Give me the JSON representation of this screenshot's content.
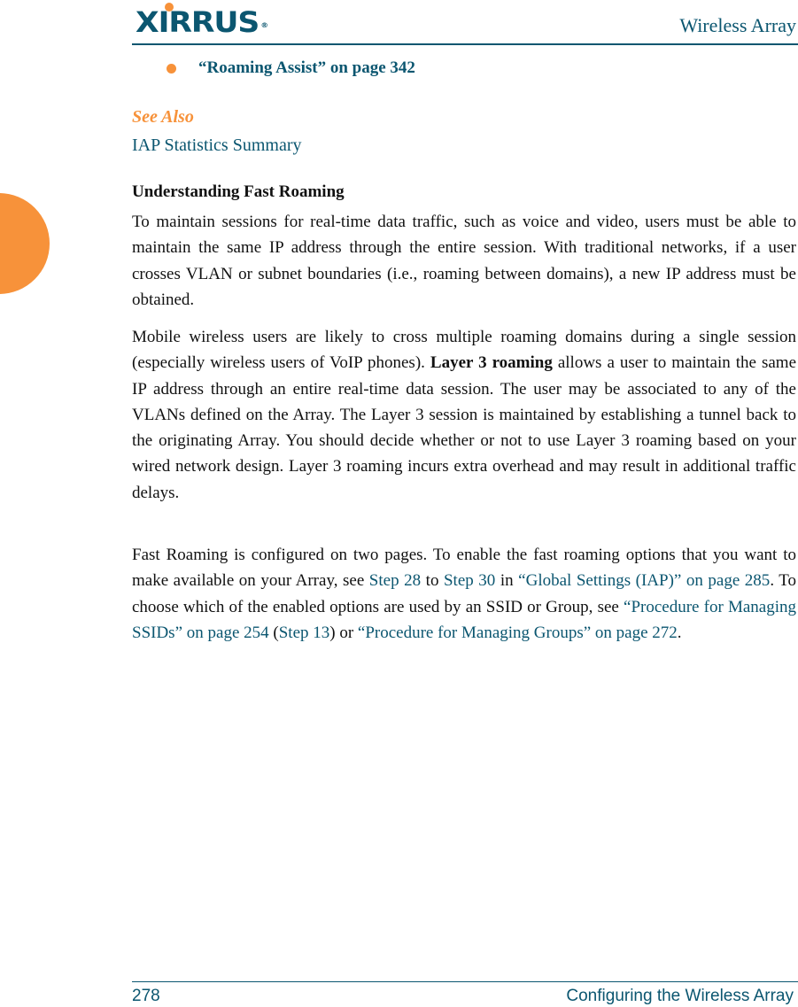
{
  "header": {
    "logo_text": "XIRRUS",
    "logo_registered": "®",
    "title": "Wireless Array"
  },
  "related_links": [
    {
      "text": "“Roaming Assist” on page 342"
    }
  ],
  "see_also": {
    "heading": "See Also",
    "links": [
      {
        "text": "IAP Statistics Summary"
      }
    ]
  },
  "section": {
    "heading": "Understanding Fast Roaming",
    "p1": "To maintain sessions for real-time data traffic, such as voice and video, users must be able to maintain the same IP address through the entire session. With traditional networks, if a user crosses VLAN or subnet boundaries (i.e., roaming between domains), a new IP address must be obtained.",
    "p2_a": "Mobile wireless users are likely to cross multiple roaming domains during a single session (especially wireless users of VoIP phones). ",
    "p2_bold": "Layer 3 roaming",
    "p2_b": " allows a user to maintain the same IP address through an entire real-time data session. The user may be associated to any of the VLANs defined on the Array. The Layer 3 session is maintained by establishing a tunnel back to the originating Array. You should decide whether or not to use Layer 3 roaming based on your wired network design. Layer 3 roaming incurs extra overhead and may result in additional traffic delays.",
    "p3": {
      "t1": "Fast Roaming is configured on two pages. To enable the fast roaming options that you want to make available on your Array, see ",
      "link1": "Step 28",
      "t2": " to ",
      "link2": "Step 30",
      "t3": " in ",
      "link3": "“Global Settings (IAP)” on page 285",
      "t4": ". To choose which of the enabled options are used by an SSID or Group, see ",
      "link4": "“Procedure for Managing SSIDs” on page 254",
      "t5": " (",
      "link5": "Step 13",
      "t6": ") or ",
      "link6": "“Procedure for Managing Groups” on page 272",
      "t7": "."
    }
  },
  "footer": {
    "page_number": "278",
    "chapter_title": "Configuring the Wireless Array"
  },
  "colors": {
    "brand": "#0b5670",
    "accent": "#f7923a"
  }
}
